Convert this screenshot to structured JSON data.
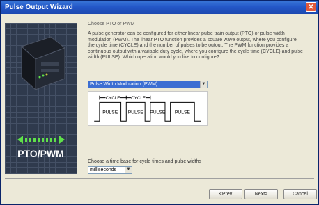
{
  "window": {
    "title": "Pulse Output Wizard",
    "close_glyph": "✕"
  },
  "left_panel": {
    "caption": "PTO/PWM"
  },
  "main": {
    "heading": "Choose PTO or PWM",
    "description": "A pulse generator can be configured for either linear pulse train output (PTO) or pulse width modulation (PWM). The linear PTO function provides a square wave output, where you configure the cycle time (CYCLE) and the number of pulses to be outout. The PWM function provides a continuous output with a variable duty cycle, where you configure the cycle time (CYCLE) and pulse width (PULSE). Which operation would you like to configure?",
    "operation_select": {
      "value": "Pulse Width Modulation (PWM)"
    },
    "diagram": {
      "cycle_label": "CYCLE",
      "pulse_label": "PULSE"
    },
    "timebase_label": "Choose a time base for cycle times and pulse widths",
    "timebase_select": {
      "value": "milliseconds"
    }
  },
  "buttons": {
    "prev": "<Prev",
    "next": "Next>",
    "cancel": "Cancel"
  },
  "colors": {
    "title_bar": "#2458c8",
    "dialog_bg": "#ece9d8",
    "left_panel": "#2f3a4d",
    "selection": "#3c6ed2",
    "arrow_accent": "#5fe04a"
  }
}
